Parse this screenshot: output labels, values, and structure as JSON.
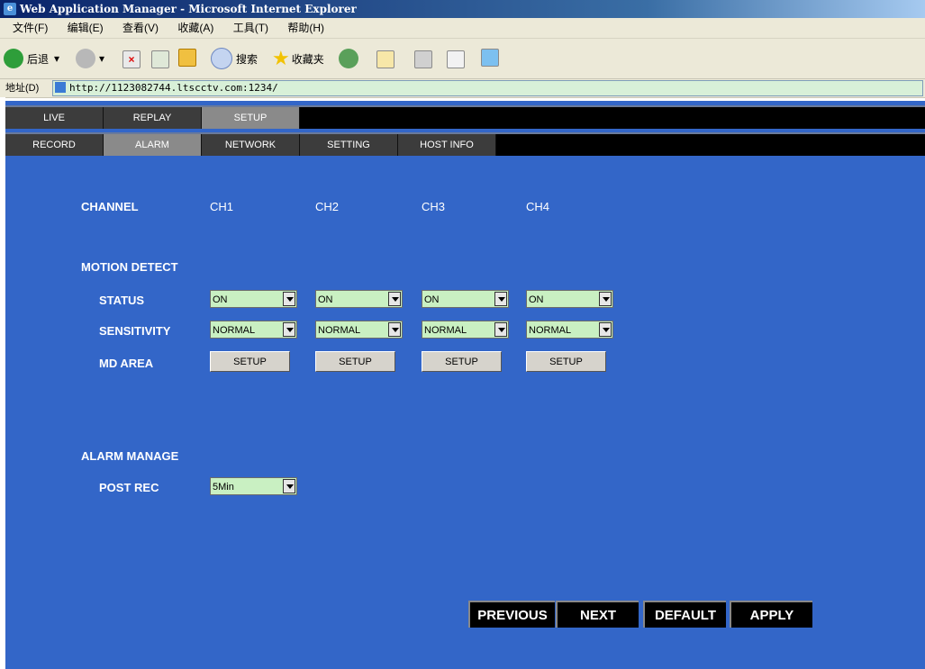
{
  "window": {
    "title": "Web Application Manager - Microsoft Internet Explorer"
  },
  "menu": [
    "文件(F)",
    "编辑(E)",
    "查看(V)",
    "收藏(A)",
    "工具(T)",
    "帮助(H)"
  ],
  "toolbar": {
    "back": "后退",
    "search": "搜索",
    "favorites": "收藏夹"
  },
  "address": {
    "label": "地址(D)",
    "url": "http://1123082744.ltscctv.com:1234/"
  },
  "nav_main": [
    {
      "label": "LIVE"
    },
    {
      "label": "REPLAY"
    },
    {
      "label": "SETUP",
      "active": true
    }
  ],
  "nav_sub": [
    {
      "label": "RECORD"
    },
    {
      "label": "ALARM",
      "active": true
    },
    {
      "label": "NETWORK"
    },
    {
      "label": "SETTING"
    },
    {
      "label": "HOST INFO"
    }
  ],
  "channel": {
    "label": "CHANNEL",
    "channels": [
      "CH1",
      "CH2",
      "CH3",
      "CH4"
    ]
  },
  "motion": {
    "heading": "MOTION DETECT",
    "status_label": "STATUS",
    "status_values": [
      "ON",
      "ON",
      "ON",
      "ON"
    ],
    "sensitivity_label": "SENSITIVITY",
    "sensitivity_values": [
      "NORMAL",
      "NORMAL",
      "NORMAL",
      "NORMAL"
    ],
    "md_area_label": "MD AREA",
    "md_area_button": "SETUP"
  },
  "alarm_manage": {
    "heading": "ALARM MANAGE",
    "post_rec_label": "POST REC",
    "post_rec_value": "5Min"
  },
  "footer": {
    "previous": "PREVIOUS",
    "next": "NEXT",
    "default": "DEFAULT",
    "apply": "APPLY"
  }
}
